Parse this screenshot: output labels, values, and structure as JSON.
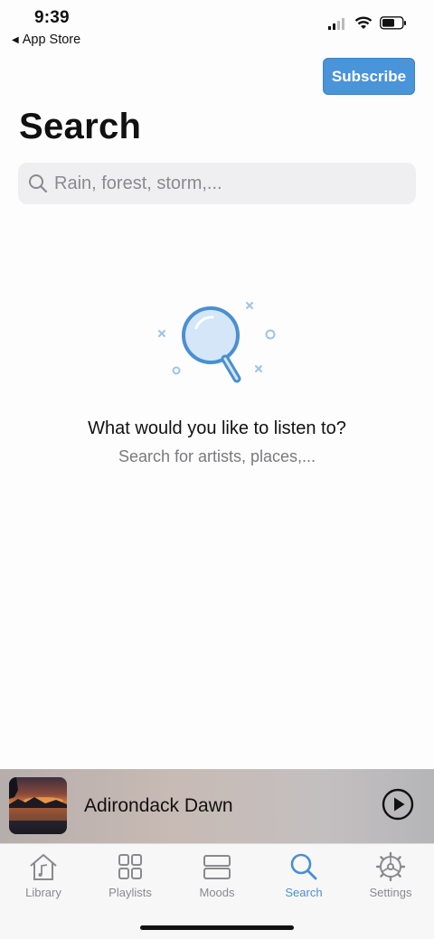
{
  "status": {
    "time": "9:39",
    "back_label": "App Store"
  },
  "header": {
    "subscribe_label": "Subscribe",
    "title": "Search"
  },
  "search": {
    "placeholder": "Rain, forest, storm,..."
  },
  "empty_state": {
    "title": "What would you like to listen to?",
    "subtitle": "Search for artists, places,..."
  },
  "now_playing": {
    "track_title": "Adirondack Dawn"
  },
  "tabs": [
    {
      "label": "Library",
      "icon": "home-note-icon",
      "active": false
    },
    {
      "label": "Playlists",
      "icon": "grid-icon",
      "active": false
    },
    {
      "label": "Moods",
      "icon": "stack-icon",
      "active": false
    },
    {
      "label": "Search",
      "icon": "search-icon",
      "active": true
    },
    {
      "label": "Settings",
      "icon": "gear-icon",
      "active": false
    }
  ],
  "colors": {
    "accent": "#4a94d9",
    "tab_active": "#4a8fd0",
    "tab_inactive": "#8a8a8e"
  }
}
